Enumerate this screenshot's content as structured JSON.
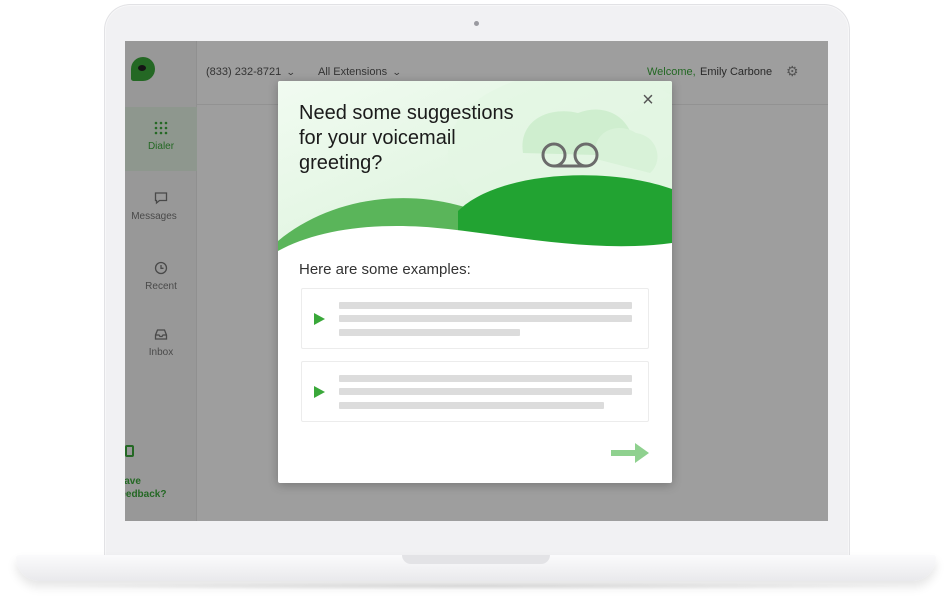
{
  "topbar": {
    "phone_number": "(833) 232-8721",
    "extensions_label": "All Extensions",
    "welcome_label": "Welcome,",
    "user_name": "Emily Carbone"
  },
  "sidebar": {
    "items": [
      {
        "label": "Dialer",
        "icon": "dialpad-icon",
        "active": true
      },
      {
        "label": "Messages",
        "icon": "chat-icon",
        "active": false
      },
      {
        "label": "Recent",
        "icon": "clock-icon",
        "active": false
      },
      {
        "label": "Inbox",
        "icon": "inbox-icon",
        "active": false
      }
    ],
    "feedback_line1": "Have",
    "feedback_line2": "feedback?"
  },
  "modal": {
    "title": "Need some suggestions for your voicemail greeting?",
    "close_symbol": "×",
    "subtitle": "Here are some examples:",
    "examples_count": 2,
    "next_icon": "arrow-right-icon"
  },
  "colors": {
    "brand_green": "#3aa83a",
    "dark_green": "#22a332",
    "light_green": "#d9f3d9",
    "overlay": "rgba(0,0,0,0.38)"
  }
}
